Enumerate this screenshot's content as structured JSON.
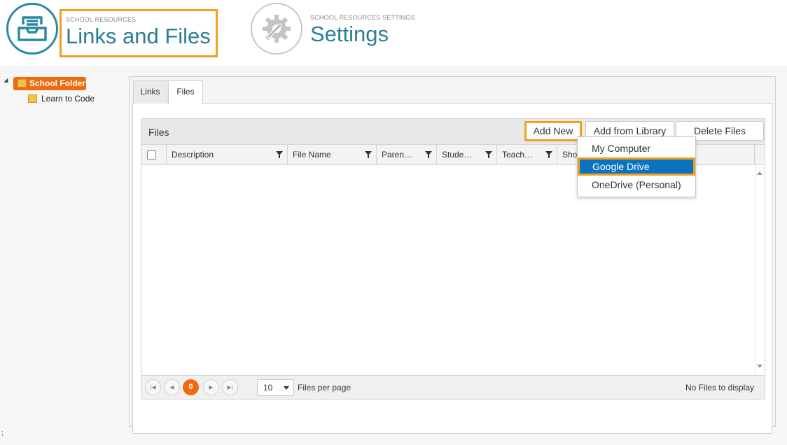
{
  "header": {
    "links_kicker": "SCHOOL RESOURCES",
    "links_title": "Links and Files",
    "settings_kicker": "SCHOOL RESOURCES SETTINGS",
    "settings_title": "Settings",
    "links_icon": "inbox-tray-icon",
    "settings_icon": "gear-wrench-icon"
  },
  "tree": {
    "root_label": "School Folder",
    "children": [
      "Learn to Code"
    ]
  },
  "footer_mark": ";",
  "tabs": [
    {
      "label": "Links",
      "active": false
    },
    {
      "label": "Files",
      "active": true
    }
  ],
  "grid": {
    "title": "Files",
    "add_new": "Add New",
    "add_from_library": "Add from Library",
    "delete_files": "Delete Files",
    "columns": [
      "Description",
      "File Name",
      "Paren…",
      "Stude…",
      "Teach…",
      "Sho"
    ]
  },
  "dropdown": {
    "items": [
      "My Computer",
      "Google Drive",
      "OneDrive (Personal)"
    ],
    "selected": "Google Drive"
  },
  "pager": {
    "current_page": "0",
    "page_size": "10",
    "page_size_label": "Files per page",
    "info": "No Files to display"
  },
  "colors": {
    "accent_orange": "#f06a10",
    "highlight_orange": "#f0a020",
    "title_teal": "#2a7f96",
    "selected_blue": "#0b74c1"
  }
}
